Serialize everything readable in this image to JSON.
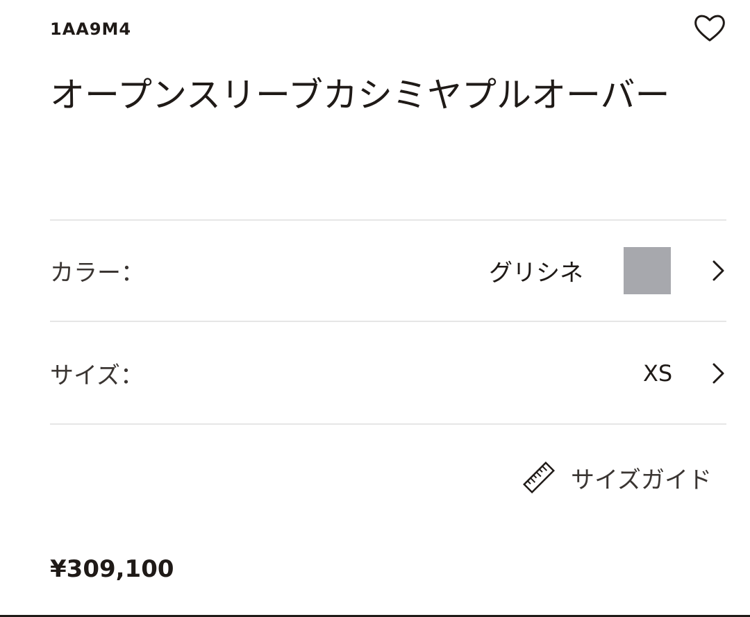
{
  "product": {
    "sku": "1AA9M4",
    "title": "オープンスリーブカシミヤプルオーバー",
    "price": "¥309,100"
  },
  "options": {
    "color": {
      "label": "カラー：",
      "value": "グリシネ",
      "swatch_color": "#a7a8ad"
    },
    "size": {
      "label": "サイズ：",
      "value": "XS"
    }
  },
  "size_guide": {
    "label": "サイズガイド",
    "icon": "ruler-icon"
  },
  "icons": {
    "wishlist": "heart-icon",
    "chevron": "chevron-right-icon"
  }
}
